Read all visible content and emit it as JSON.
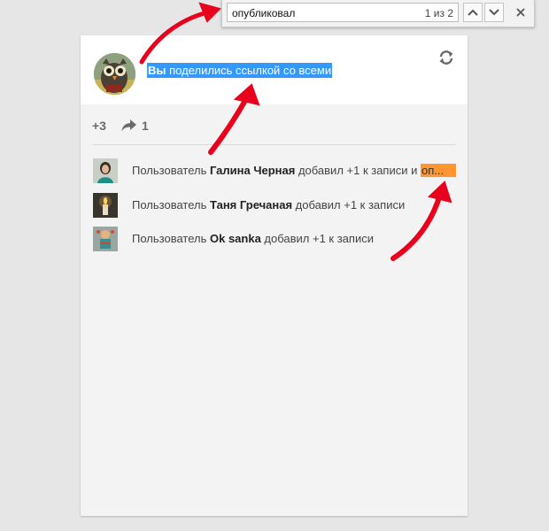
{
  "findbar": {
    "query": "опубликовал",
    "count": "1 из 2"
  },
  "post": {
    "title_highlight": "Вы",
    "title_rest": " поделились ссылкой со всеми",
    "plus_count": "+3",
    "share_count": "1"
  },
  "activities": [
    {
      "prefix": "Пользователь ",
      "user": "Галина Черная",
      "suffix": " добавил +1 к записи и ",
      "highlight": "оп..."
    },
    {
      "prefix": "Пользователь ",
      "user": "Таня Гречаная",
      "suffix": " добавил +1 к записи"
    },
    {
      "prefix": "Пользователь ",
      "user": "Ok sanka",
      "suffix": " добавил +1 к записи"
    }
  ],
  "colors": {
    "selection": "#3399ff",
    "find_highlight": "#ff9632",
    "annotation_arrow": "#e8001c"
  }
}
